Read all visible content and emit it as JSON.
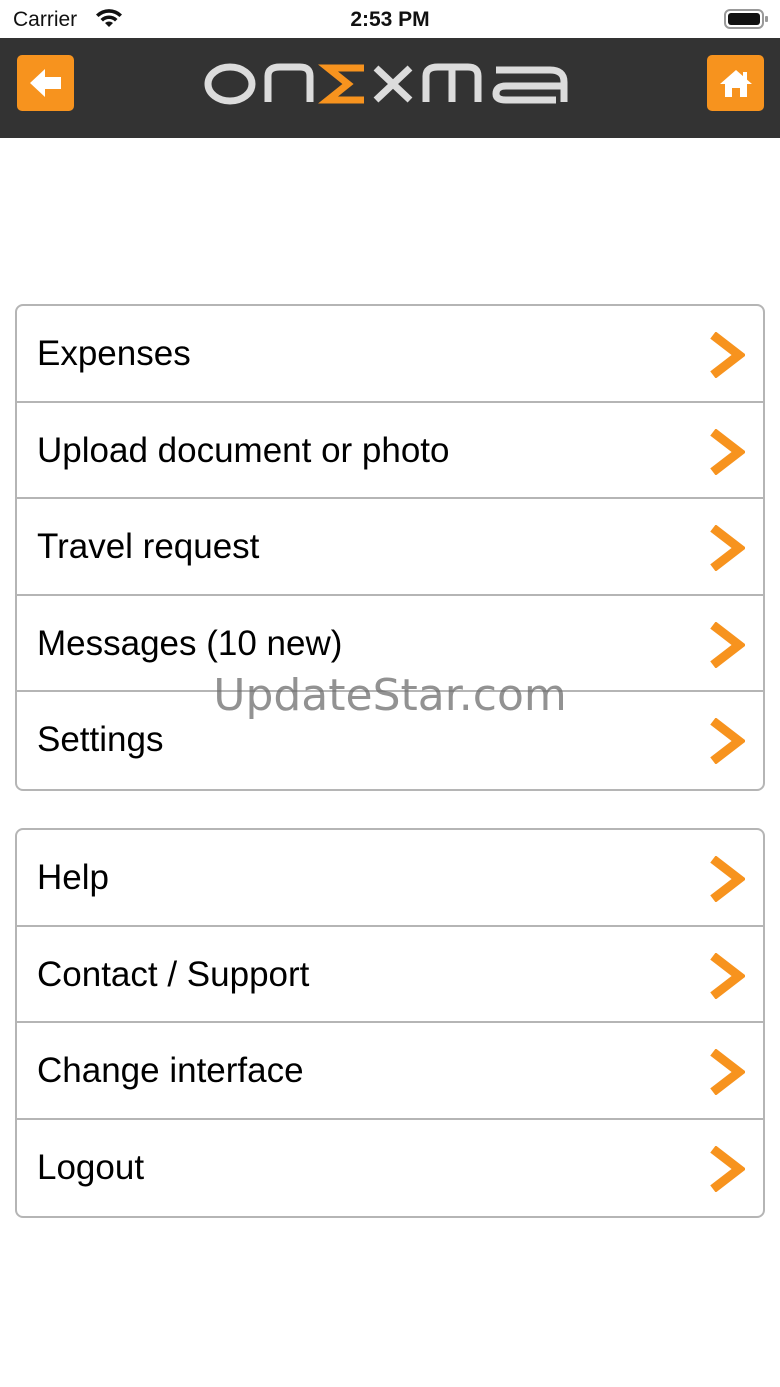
{
  "status_bar": {
    "carrier": "Carrier",
    "time": "2:53 PM",
    "wifi_icon": "wifi-icon",
    "battery_icon": "battery-icon"
  },
  "nav_bar": {
    "logo_text": "onΣxma",
    "back_icon": "arrow-left-icon",
    "home_icon": "home-icon",
    "accent_color": "#f7931e",
    "background_color": "#333333"
  },
  "menu": {
    "group1": [
      {
        "label": "Expenses"
      },
      {
        "label": "Upload document or photo"
      },
      {
        "label": "Travel request"
      },
      {
        "label": "Messages (10 new)"
      },
      {
        "label": "Settings"
      }
    ],
    "group2": [
      {
        "label": "Help"
      },
      {
        "label": "Contact / Support"
      },
      {
        "label": "Change interface"
      },
      {
        "label": "Logout"
      }
    ],
    "chevron_icon": "chevron-right-icon",
    "chevron_color": "#f7931e"
  },
  "watermark": "UpdateStar.com"
}
